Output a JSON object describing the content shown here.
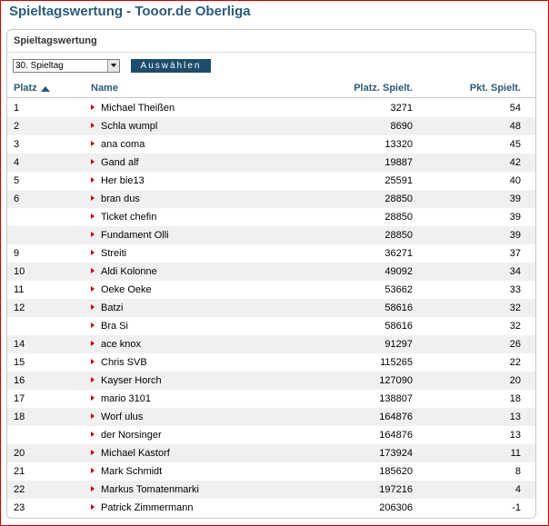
{
  "page": {
    "title": "Spieltagswertung - Tooor.de Oberliga"
  },
  "panel": {
    "title": "Spieltagswertung"
  },
  "filter": {
    "selected": "30. Spieltag",
    "button_label": "Auswählen"
  },
  "table": {
    "columns": {
      "platz": "Platz",
      "name": "Name",
      "platz_spielt": "Platz. Spielt.",
      "pkt_spielt": "Pkt. Spielt."
    },
    "rows": [
      {
        "platz": "1",
        "name": "Michael Theißen",
        "platz_spielt": "3271",
        "pkt": "54"
      },
      {
        "platz": "2",
        "name": "Schla wumpl",
        "platz_spielt": "8690",
        "pkt": "48"
      },
      {
        "platz": "3",
        "name": "ana coma",
        "platz_spielt": "13320",
        "pkt": "45"
      },
      {
        "platz": "4",
        "name": "Gand alf",
        "platz_spielt": "19887",
        "pkt": "42"
      },
      {
        "platz": "5",
        "name": "Her bie13",
        "platz_spielt": "25591",
        "pkt": "40"
      },
      {
        "platz": "6",
        "name": "bran dus",
        "platz_spielt": "28850",
        "pkt": "39"
      },
      {
        "platz": "",
        "name": "Ticket chefin",
        "platz_spielt": "28850",
        "pkt": "39"
      },
      {
        "platz": "",
        "name": "Fundament Olli",
        "platz_spielt": "28850",
        "pkt": "39"
      },
      {
        "platz": "9",
        "name": "Streiti",
        "platz_spielt": "36271",
        "pkt": "37"
      },
      {
        "platz": "10",
        "name": "Aldi Kolonne",
        "platz_spielt": "49092",
        "pkt": "34"
      },
      {
        "platz": "11",
        "name": "Oeke Oeke",
        "platz_spielt": "53662",
        "pkt": "33"
      },
      {
        "platz": "12",
        "name": "Batzi",
        "platz_spielt": "58616",
        "pkt": "32"
      },
      {
        "platz": "",
        "name": "Bra Si",
        "platz_spielt": "58616",
        "pkt": "32"
      },
      {
        "platz": "14",
        "name": "ace knox",
        "platz_spielt": "91297",
        "pkt": "26"
      },
      {
        "platz": "15",
        "name": "Chris SVB",
        "platz_spielt": "115265",
        "pkt": "22"
      },
      {
        "platz": "16",
        "name": "Kayser Horch",
        "platz_spielt": "127090",
        "pkt": "20"
      },
      {
        "platz": "17",
        "name": "mario 3101",
        "platz_spielt": "138807",
        "pkt": "18"
      },
      {
        "platz": "18",
        "name": "Worf ulus",
        "platz_spielt": "164876",
        "pkt": "13"
      },
      {
        "platz": "",
        "name": "der Norsinger",
        "platz_spielt": "164876",
        "pkt": "13"
      },
      {
        "platz": "20",
        "name": "Michael Kastorf",
        "platz_spielt": "173924",
        "pkt": "11"
      },
      {
        "platz": "21",
        "name": "Mark Schmidt",
        "platz_spielt": "185620",
        "pkt": "8"
      },
      {
        "platz": "22",
        "name": "Markus Tomatenmarki",
        "platz_spielt": "197216",
        "pkt": "4"
      },
      {
        "platz": "23",
        "name": "Patrick Zimmermann",
        "platz_spielt": "206306",
        "pkt": "-1"
      }
    ]
  },
  "colors": {
    "title": "#2b5a78",
    "button": "#1d4c6c",
    "bullet": "#c00000",
    "frame": "#d20000",
    "row_alt": "#f0f0f0"
  }
}
